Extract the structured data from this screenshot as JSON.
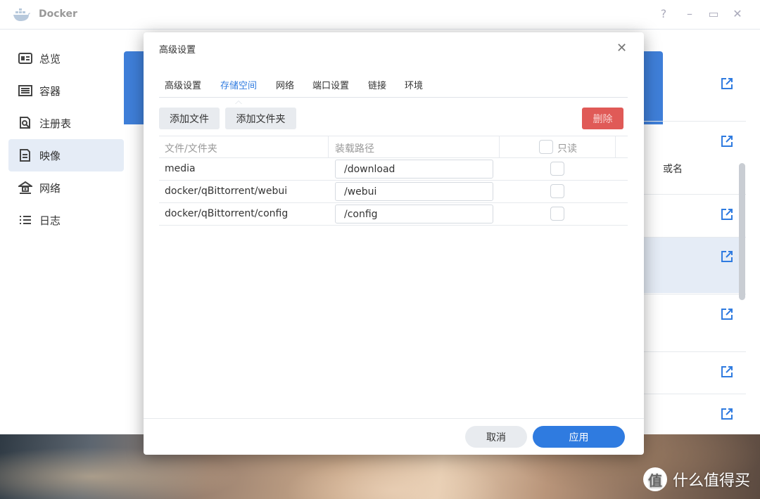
{
  "window": {
    "title": "Docker",
    "controls": [
      "?",
      "–",
      "▭",
      "✕"
    ]
  },
  "sidebar": {
    "items": [
      {
        "label": "总览",
        "icon": "overview-icon"
      },
      {
        "label": "容器",
        "icon": "container-icon"
      },
      {
        "label": "注册表",
        "icon": "registry-icon"
      },
      {
        "label": "映像",
        "icon": "image-icon",
        "active": true
      },
      {
        "label": "网络",
        "icon": "network-icon"
      },
      {
        "label": "日志",
        "icon": "log-icon"
      }
    ]
  },
  "background": {
    "partial_text": "或名"
  },
  "dialog": {
    "title": "高级设置",
    "tabs": [
      "高级设置",
      "存储空间",
      "网络",
      "端口设置",
      "链接",
      "环境"
    ],
    "active_tab": "存储空间",
    "toolbar": {
      "add_file": "添加文件",
      "add_folder": "添加文件夹",
      "delete": "删除"
    },
    "table": {
      "headers": {
        "folder": "文件/文件夹",
        "mount_path": "装载路径",
        "readonly": "只读"
      },
      "rows": [
        {
          "folder": "media",
          "mount_path": "/download",
          "readonly": false
        },
        {
          "folder": "docker/qBittorrent/webui",
          "mount_path": "/webui",
          "readonly": false
        },
        {
          "folder": "docker/qBittorrent/config",
          "mount_path": "/config",
          "readonly": false
        }
      ]
    },
    "footer": {
      "cancel": "取消",
      "apply": "应用"
    }
  },
  "watermark": {
    "badge": "值",
    "text": "什么值得买"
  },
  "colors": {
    "accent": "#2f7be0",
    "danger": "#e05a57",
    "sidebar_active": "#e5ecf6"
  }
}
